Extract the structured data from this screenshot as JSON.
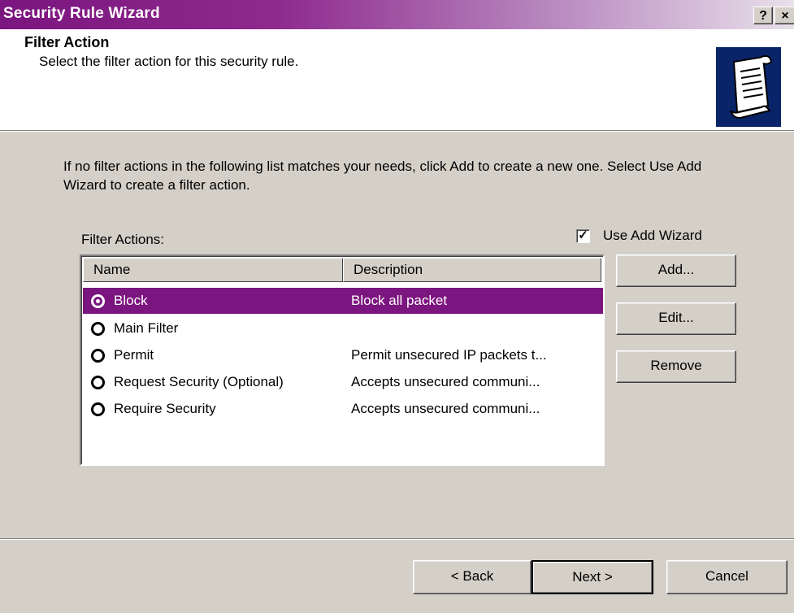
{
  "window": {
    "title": "Security Rule Wizard",
    "help_label": "?",
    "close_label": "×",
    "title_gradient_start": "#7b157f"
  },
  "header": {
    "title": "Filter Action",
    "subtitle": "Select the filter action for this security rule.",
    "icon": "scroll-document-icon"
  },
  "body": {
    "intro": "If no filter actions in the following list matches your needs, click Add to create a new one. Select Use Add Wizard to create a filter action.",
    "filter_actions_label": "Filter Actions:",
    "use_add_wizard": {
      "label": "Use Add Wizard",
      "checked": true,
      "mark": "✓"
    }
  },
  "list": {
    "columns": {
      "name": "Name",
      "description": "Description"
    },
    "selection_color": "#7b157f",
    "rows": [
      {
        "name": "Block",
        "description": "Block all packet",
        "selected": true
      },
      {
        "name": "Main Filter",
        "description": "",
        "selected": false
      },
      {
        "name": "Permit",
        "description": "Permit unsecured IP packets t...",
        "selected": false
      },
      {
        "name": "Request Security (Optional)",
        "description": "Accepts unsecured communi...",
        "selected": false
      },
      {
        "name": "Require Security",
        "description": "Accepts unsecured communi...",
        "selected": false
      }
    ]
  },
  "side_buttons": {
    "add": "Add...",
    "edit": "Edit...",
    "remove": "Remove"
  },
  "footer": {
    "back": "< Back",
    "next": "Next >",
    "cancel": "Cancel"
  }
}
